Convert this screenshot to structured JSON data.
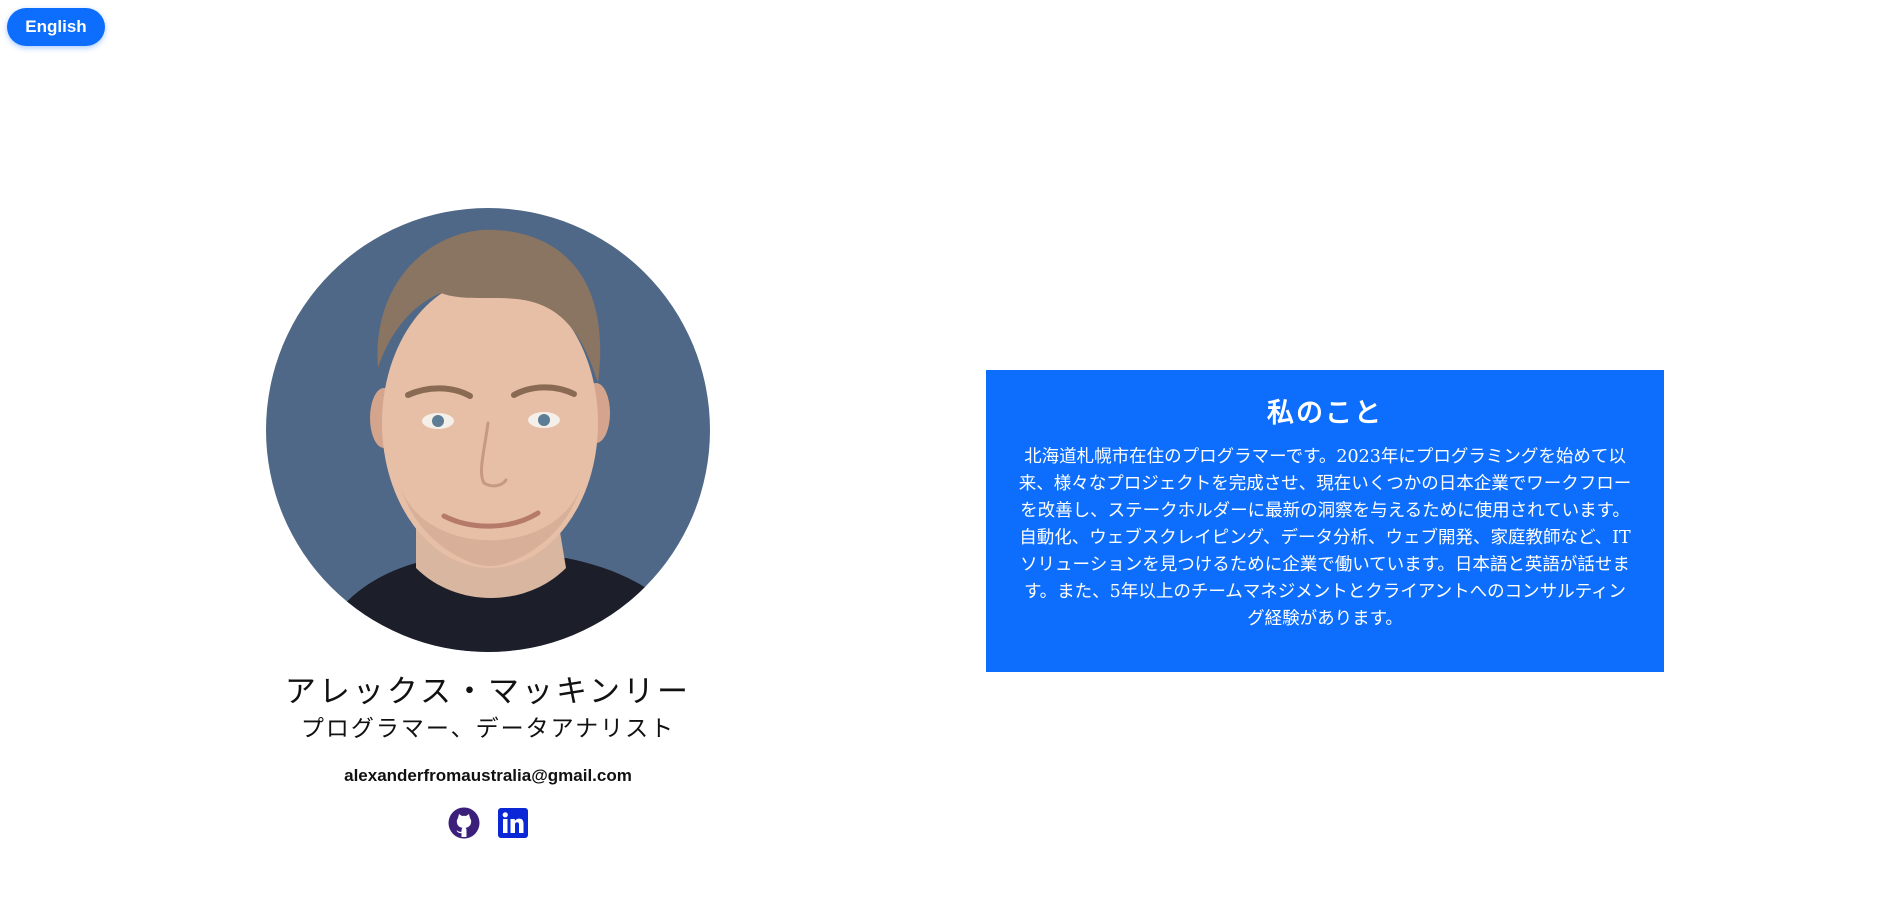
{
  "header": {
    "language_button_label": "English"
  },
  "profile": {
    "photo_alt": "アレックス・マッキンリー",
    "name": "アレックス・マッキンリー",
    "role": "プログラマー、データアナリスト",
    "email": "alexanderfromaustralia@gmail.com",
    "socials": [
      {
        "icon": "github-icon",
        "color": "#3b1f7a"
      },
      {
        "icon": "linkedin-icon",
        "color": "#0a28d6"
      }
    ]
  },
  "about": {
    "title": "私のこと",
    "text": "北海道札幌市在住のプログラマーです。2023年にプログラミングを始めて以来、様々なプロジェクトを完成させ、現在いくつかの日本企業でワークフローを改善し、ステークホルダーに最新の洞察を与えるために使用されています。自動化、ウェブスクレイピング、データ分析、ウェブ開発、家庭教師など、ITソリューションを見つけるために企業で働いています。日本語と英語が話せます。また、5年以上のチームマネジメントとクライアントへのコンサルティング経験があります。"
  },
  "colors": {
    "accent": "#0d6efd",
    "avatar_background": "#506887"
  }
}
